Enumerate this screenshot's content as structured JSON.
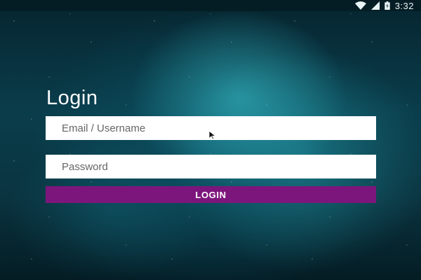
{
  "status_bar": {
    "time": "3:32",
    "icons": [
      "wifi-icon",
      "signal-icon",
      "battery-icon"
    ]
  },
  "login": {
    "title": "Login",
    "email_placeholder": "Email / Username",
    "email_value": "",
    "password_placeholder": "Password",
    "password_value": "",
    "button_label": "LOGIN"
  },
  "colors": {
    "button": "#7d167c",
    "field_background": "#ffffff",
    "title_text": "#ffffff",
    "background_dark": "#06252f",
    "background_glow": "#3cc8d2"
  }
}
